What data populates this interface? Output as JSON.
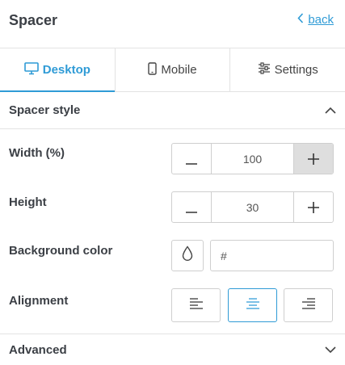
{
  "header": {
    "title": "Spacer",
    "back_label": "back"
  },
  "tabs": [
    {
      "label": "Desktop",
      "icon": "desktop-icon",
      "active": true
    },
    {
      "label": "Mobile",
      "icon": "mobile-icon",
      "active": false
    },
    {
      "label": "Settings",
      "icon": "sliders-icon",
      "active": false
    }
  ],
  "section": {
    "title": "Spacer style",
    "expanded": true
  },
  "width": {
    "label": "Width (%)",
    "value": "100"
  },
  "height": {
    "label": "Height",
    "value": "30"
  },
  "background": {
    "label": "Background color",
    "value": "#"
  },
  "alignment": {
    "label": "Alignment",
    "options": [
      "left",
      "center",
      "right"
    ],
    "selected": "center"
  },
  "advanced": {
    "title": "Advanced",
    "expanded": false
  },
  "colors": {
    "accent": "#2f9bd6",
    "text": "#3b3f45",
    "border": "#cfcfcf",
    "divider": "#e3e3e3",
    "hover": "#dedede"
  }
}
